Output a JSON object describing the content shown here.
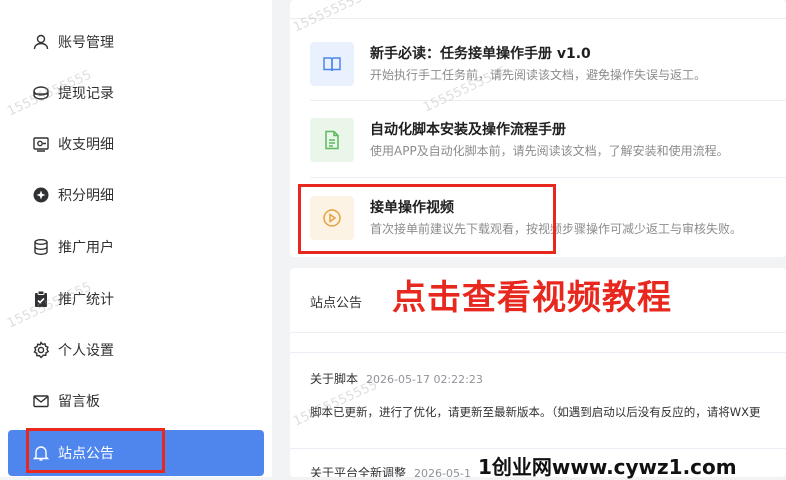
{
  "sidebar": {
    "items": [
      {
        "label": "账号管理",
        "icon": "user-icon"
      },
      {
        "label": "提现记录",
        "icon": "wallet-icon"
      },
      {
        "label": "收支明细",
        "icon": "ledger-icon"
      },
      {
        "label": "积分明细",
        "icon": "points-icon"
      },
      {
        "label": "推广用户",
        "icon": "database-icon"
      },
      {
        "label": "推广统计",
        "icon": "clipboard-icon"
      },
      {
        "label": "个人设置",
        "icon": "gear-icon"
      },
      {
        "label": "留言板",
        "icon": "mail-icon"
      },
      {
        "label": "站点公告",
        "icon": "bell-icon",
        "active": true
      }
    ]
  },
  "docs": [
    {
      "title": "新手必读：任务接单操作手册 v1.0",
      "desc": "开始执行手工任务前，请先阅读该文档，避免操作失误与返工。",
      "icon": "book-icon"
    },
    {
      "title": "自动化脚本安装及操作流程手册",
      "desc": "使用APP及自动化脚本前，请先阅读该文档，了解安装和使用流程。",
      "icon": "document-icon"
    },
    {
      "title": "接单操作视频",
      "desc": "首次接单前建议先下载观看，按视频步骤操作可减少返工与审核失败。",
      "icon": "play-icon"
    }
  ],
  "notice": {
    "header": "站点公告",
    "items": [
      {
        "title": "关于脚本",
        "date": "2026-05-17 02:22:23",
        "body": "脚本已更新，进行了优化，请更新至最新版本。（如遇到启动以后没有反应的，请将WX更"
      },
      {
        "title": "关于平台全新调整",
        "date": "2026-05-1"
      }
    ]
  },
  "annotation": {
    "text": "点击查看视频教程"
  },
  "watermark": "15555555555",
  "site_mark": "1创业网www.cywz1.com",
  "colors": {
    "accent": "#4f86ee",
    "annotation": "#e8281e"
  }
}
